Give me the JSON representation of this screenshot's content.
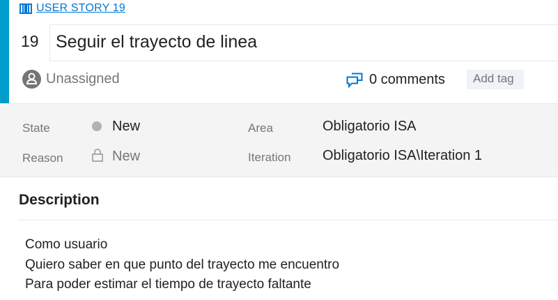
{
  "work_item": {
    "type_label": "USER STORY 19",
    "id": "19",
    "title": "Seguir el trayecto de linea",
    "assignee": "Unassigned",
    "comments": "0 comments",
    "add_tag": "Add tag"
  },
  "fields": {
    "state": {
      "label": "State",
      "value": "New"
    },
    "reason": {
      "label": "Reason",
      "value": "New"
    },
    "area": {
      "label": "Area",
      "value": "Obligatorio ISA"
    },
    "iteration": {
      "label": "Iteration",
      "value": "Obligatorio ISA\\Iteration 1"
    }
  },
  "description": {
    "heading": "Description",
    "lines": [
      "Como usuario",
      "Quiero saber en que punto del trayecto me encuentro",
      "Para poder estimar el tiempo de trayecto faltante"
    ]
  },
  "colors": {
    "accent": "#009ccc",
    "link": "#0078d4",
    "state_dot": "#b2b2b2"
  },
  "icons": [
    "book-icon",
    "user-icon",
    "comments-icon",
    "lock-icon"
  ]
}
